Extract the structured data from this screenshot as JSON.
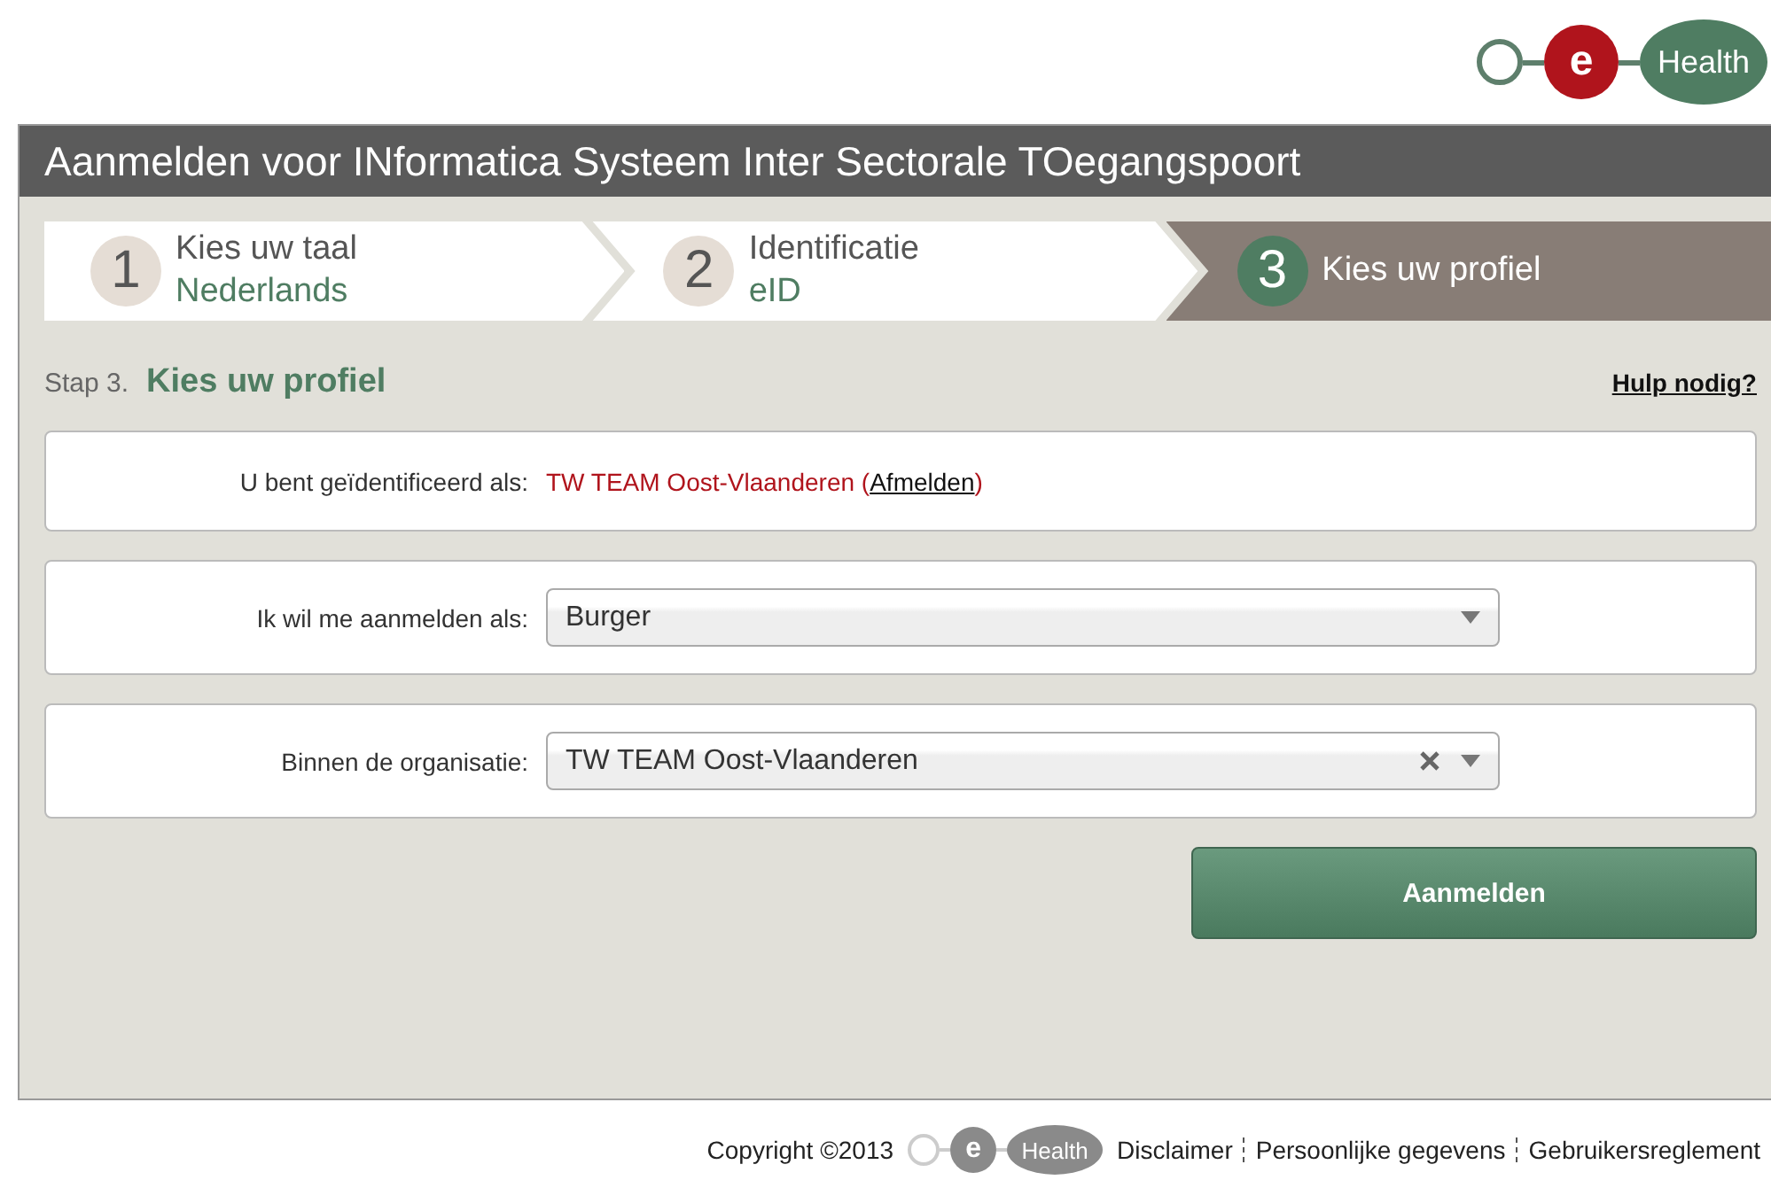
{
  "logo": {
    "letter": "e",
    "word": "Health"
  },
  "window": {
    "title": "Aanmelden voor INformatica Systeem Inter Sectorale TOegangspoort"
  },
  "steps": [
    {
      "number": "1",
      "label": "Kies uw taal",
      "value": "Nederlands",
      "selected": false
    },
    {
      "number": "2",
      "label": "Identificatie",
      "value": "eID",
      "selected": false
    },
    {
      "number": "3",
      "label": "Kies uw profiel",
      "selected": true
    }
  ],
  "step_heading": {
    "prefix": "Stap 3.",
    "title": "Kies uw profiel"
  },
  "help_link": "Hulp nodig?",
  "identity": {
    "label": "U bent geïdentificeerd als:",
    "name": "TW TEAM Oost-Vlaanderen",
    "open": "(",
    "link": "Afmelden",
    "close": ")"
  },
  "fields": [
    {
      "label": "Ik wil me aanmelden als:",
      "value": "Burger",
      "clearable": false
    },
    {
      "label": "Binnen de organisatie:",
      "value": "TW TEAM Oost-Vlaanderen",
      "clearable": true
    }
  ],
  "submit_button": "Aanmelden",
  "footer": {
    "copyright": "Copyright ©2013",
    "logo_letter": "e",
    "logo_word": "Health",
    "links": [
      "Disclaimer",
      "Persoonlijke gegevens",
      "Gebruikersreglement"
    ]
  }
}
